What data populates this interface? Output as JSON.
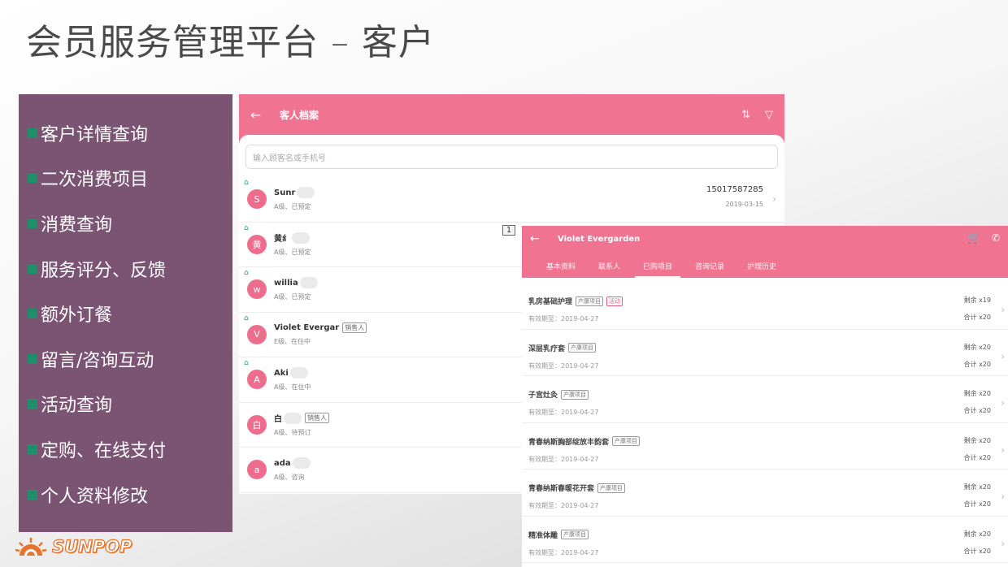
{
  "slide": {
    "title": "会员服务管理平台 – 客户",
    "features": [
      "客户详情查询",
      "二次消费项目",
      "消费查询",
      "服务评分、反馈",
      "额外订餐",
      "留言/咨询互动",
      "活动查询",
      "定购、在线支付",
      "个人资料修改"
    ],
    "logo_text": "SUNPOP"
  },
  "screen1": {
    "title": "客人档案",
    "search_placeholder": "输入顾客名或手机号",
    "badge": "1",
    "customers": [
      {
        "avatar": "S",
        "name": "Sunr",
        "seller": "",
        "sub": "A级、已预定",
        "phone": "15017587285",
        "date": "2019-03-15"
      },
      {
        "avatar": "黄",
        "name": "黄纟",
        "seller": "",
        "sub": "A级、已预定",
        "phone": "",
        "date": ""
      },
      {
        "avatar": "w",
        "name": "willia",
        "seller": "",
        "sub": "A级、已预定",
        "phone": "",
        "date": ""
      },
      {
        "avatar": "V",
        "name": "Violet Evergar",
        "seller": "销售人",
        "sub": "E级、在住中",
        "phone": "",
        "date": ""
      },
      {
        "avatar": "A",
        "name": "Aki",
        "seller": "",
        "sub": "A级、在住中",
        "phone": "",
        "date": ""
      },
      {
        "avatar": "白",
        "name": "白",
        "seller": "销售人",
        "sub": "A级、待预订",
        "phone": "",
        "date": ""
      },
      {
        "avatar": "a",
        "name": "ada",
        "seller": "",
        "sub": "A级、咨询",
        "phone": "",
        "date": ""
      }
    ]
  },
  "screen2": {
    "title": "Violet Evergarden",
    "tabs": [
      "基本资料",
      "联系人",
      "已购项目",
      "咨询记录",
      "护理历史"
    ],
    "active_tab": 2,
    "items": [
      {
        "name": "乳房基础护理",
        "type": "产康项目",
        "promo": "活动",
        "expiry": "有效期至：2019-04-27",
        "remain": "剩余 x19",
        "total": "合计 x20"
      },
      {
        "name": "深层乳疗套",
        "type": "产康项目",
        "promo": "",
        "expiry": "有效期至：2019-04-27",
        "remain": "剩余 x20",
        "total": "合计 x20"
      },
      {
        "name": "子宫灶灸",
        "type": "产康项目",
        "promo": "",
        "expiry": "有效期至：2019-04-27",
        "remain": "剩余 x20",
        "total": "合计 x20"
      },
      {
        "name": "青春纳斯胸部绽放丰韵套",
        "type": "产康项目",
        "promo": "",
        "expiry": "有效期至：2019-04-27",
        "remain": "剩余 x20",
        "total": "合计 x20"
      },
      {
        "name": "青春纳斯春暖花开套",
        "type": "产康项目",
        "promo": "",
        "expiry": "有效期至：2019-04-27",
        "remain": "剩余 x20",
        "total": "合计 x20"
      },
      {
        "name": "精准体雕",
        "type": "产康项目",
        "promo": "",
        "expiry": "有效期至：2019-04-27",
        "remain": "剩余 x20",
        "total": "合计 x20"
      }
    ]
  },
  "colors": {
    "brand_pink": "#f07392",
    "panel_purple": "#7b5473",
    "bullet_green": "#1f8f6a"
  }
}
